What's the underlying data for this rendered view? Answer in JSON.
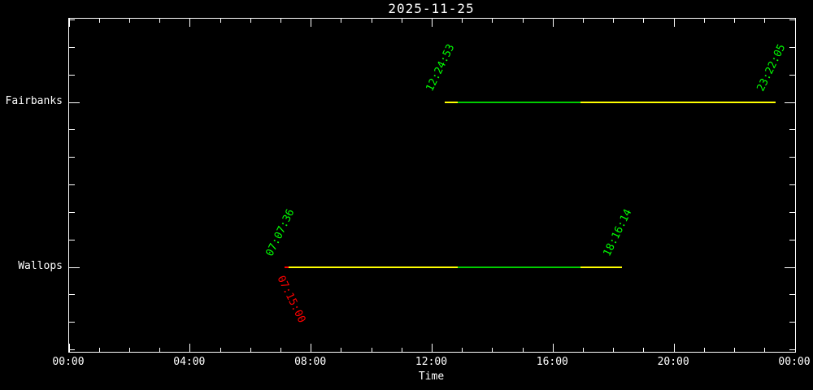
{
  "title": "2025-11-25",
  "xlabel": "Time",
  "colors": {
    "background": "#000000",
    "frame": "#ffffff",
    "text": "#ffffff",
    "label_green": "#00ff00",
    "label_red": "#ff0000",
    "line_yellow": "#ffff00",
    "line_green": "#00cc00",
    "line_red": "#ff0000"
  },
  "chart_data": {
    "type": "timeline",
    "title": "2025-11-25",
    "xlabel": "Time",
    "x_axis": {
      "range_hours": [
        0,
        24
      ],
      "major_tick_labels": [
        "00:00",
        "04:00",
        "08:00",
        "12:00",
        "16:00",
        "20:00",
        "00:00"
      ],
      "major_tick_hours": [
        0,
        4,
        8,
        12,
        16,
        20,
        24
      ],
      "minor_tick_every_hours": 1,
      "grid": "off"
    },
    "legend": "none",
    "rows": [
      {
        "station": "Fairbanks",
        "pass_start": "12:24:53",
        "pass_end": "23:22:05",
        "segments": [
          {
            "from": "12:24:53",
            "to": "12:51",
            "color": "line_yellow"
          },
          {
            "from": "12:51",
            "to": "16:54",
            "color": "line_green"
          },
          {
            "from": "16:54",
            "to": "23:22:05",
            "color": "line_yellow"
          }
        ],
        "labels": [
          {
            "text": "12:24:53",
            "time": "12:24:53",
            "color": "label_green",
            "placement": "above"
          },
          {
            "text": "23:22:05",
            "time": "23:22:05",
            "color": "label_green",
            "placement": "above"
          }
        ]
      },
      {
        "station": "Wallops",
        "pass_start": "07:07:36",
        "pass_end": "18:16:14",
        "segments": [
          {
            "from": "07:07:36",
            "to": "07:15:00",
            "color": "line_red"
          },
          {
            "from": "07:15:00",
            "to": "12:51",
            "color": "line_yellow"
          },
          {
            "from": "12:51",
            "to": "16:54",
            "color": "line_green"
          },
          {
            "from": "16:54",
            "to": "18:16:14",
            "color": "line_yellow"
          }
        ],
        "labels": [
          {
            "text": "07:07:36",
            "time": "07:07:36",
            "color": "label_green",
            "placement": "above"
          },
          {
            "text": "18:16:14",
            "time": "18:16:14",
            "color": "label_green",
            "placement": "above"
          },
          {
            "text": "07:15:00",
            "time": "07:15:00",
            "color": "label_red",
            "placement": "below"
          }
        ]
      }
    ]
  }
}
